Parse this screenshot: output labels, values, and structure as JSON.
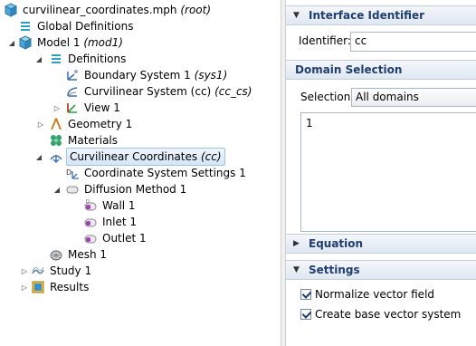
{
  "tree": {
    "root": {
      "label": "curvilinear_coordinates.mph",
      "tag": "(root)"
    },
    "global_definitions": "Global Definitions",
    "model": {
      "label": "Model 1",
      "tag": "(mod1)"
    },
    "definitions": "Definitions",
    "boundary_system": {
      "label": "Boundary System 1",
      "tag": "(sys1)"
    },
    "curvilinear_system": {
      "label": "Curvilinear System (cc)",
      "tag": "(cc_cs)"
    },
    "view": "View 1",
    "geometry": "Geometry 1",
    "materials": "Materials",
    "curvilinear_coordinates": {
      "label": "Curvilinear Coordinates",
      "tag": "(cc)"
    },
    "coord_system_settings": "Coordinate System Settings 1",
    "diffusion_method": "Diffusion Method 1",
    "wall": "Wall 1",
    "inlet": "Inlet 1",
    "outlet": "Outlet 1",
    "mesh": "Mesh 1",
    "study": "Study 1",
    "results": "Results"
  },
  "panel": {
    "interface_identifier": {
      "title": "Interface Identifier",
      "identifier_label": "Identifier:",
      "identifier_value": "cc"
    },
    "domain_selection": {
      "title": "Domain Selection",
      "selection_label": "Selection:",
      "selection_value": "All domains",
      "list_items": [
        "1"
      ]
    },
    "equation": {
      "title": "Equation"
    },
    "settings": {
      "title": "Settings",
      "normalize_label": "Normalize vector field",
      "normalize_checked": true,
      "base_vector_label": "Create base vector system",
      "base_vector_checked": true
    }
  },
  "colors": {
    "section_title": "#1f3f72",
    "selection_highlight": "#d6e6f8"
  }
}
